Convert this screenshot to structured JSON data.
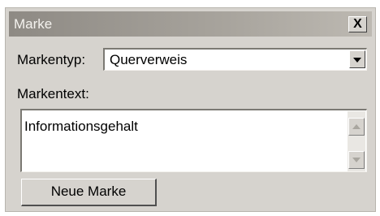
{
  "window": {
    "title": "Marke",
    "close_label": "X"
  },
  "form": {
    "markentyp_label": "Markentyp:",
    "markentyp_value": "Querverweis",
    "markentext_label": "Markentext:",
    "markentext_value": "Informationsgehalt"
  },
  "actions": {
    "new_mark_label": "Neue Marke"
  },
  "icons": {
    "close": "close-icon",
    "dropdown": "chevron-down-icon",
    "scroll_up": "arrow-up-icon",
    "scroll_down": "arrow-down-icon"
  },
  "colors": {
    "dialog_bg": "#d6d3ce",
    "titlebar": "#8e8a84"
  }
}
